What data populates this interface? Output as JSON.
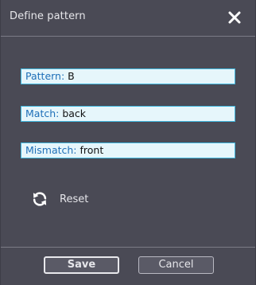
{
  "dialog": {
    "title": "Define pattern",
    "close_icon": "close-icon"
  },
  "fields": [
    {
      "label": "Pattern:",
      "value": "B"
    },
    {
      "label": "Match:",
      "value": "back"
    },
    {
      "label": "Mismatch:",
      "value": "front"
    }
  ],
  "reset": {
    "icon": "refresh-icon",
    "label": "Reset"
  },
  "footer": {
    "save_label": "Save",
    "cancel_label": "Cancel"
  },
  "colors": {
    "background": "#4a4a55",
    "field_background": "#e6f6fb",
    "field_border": "#41b8df",
    "field_label": "#1e6fb8"
  }
}
